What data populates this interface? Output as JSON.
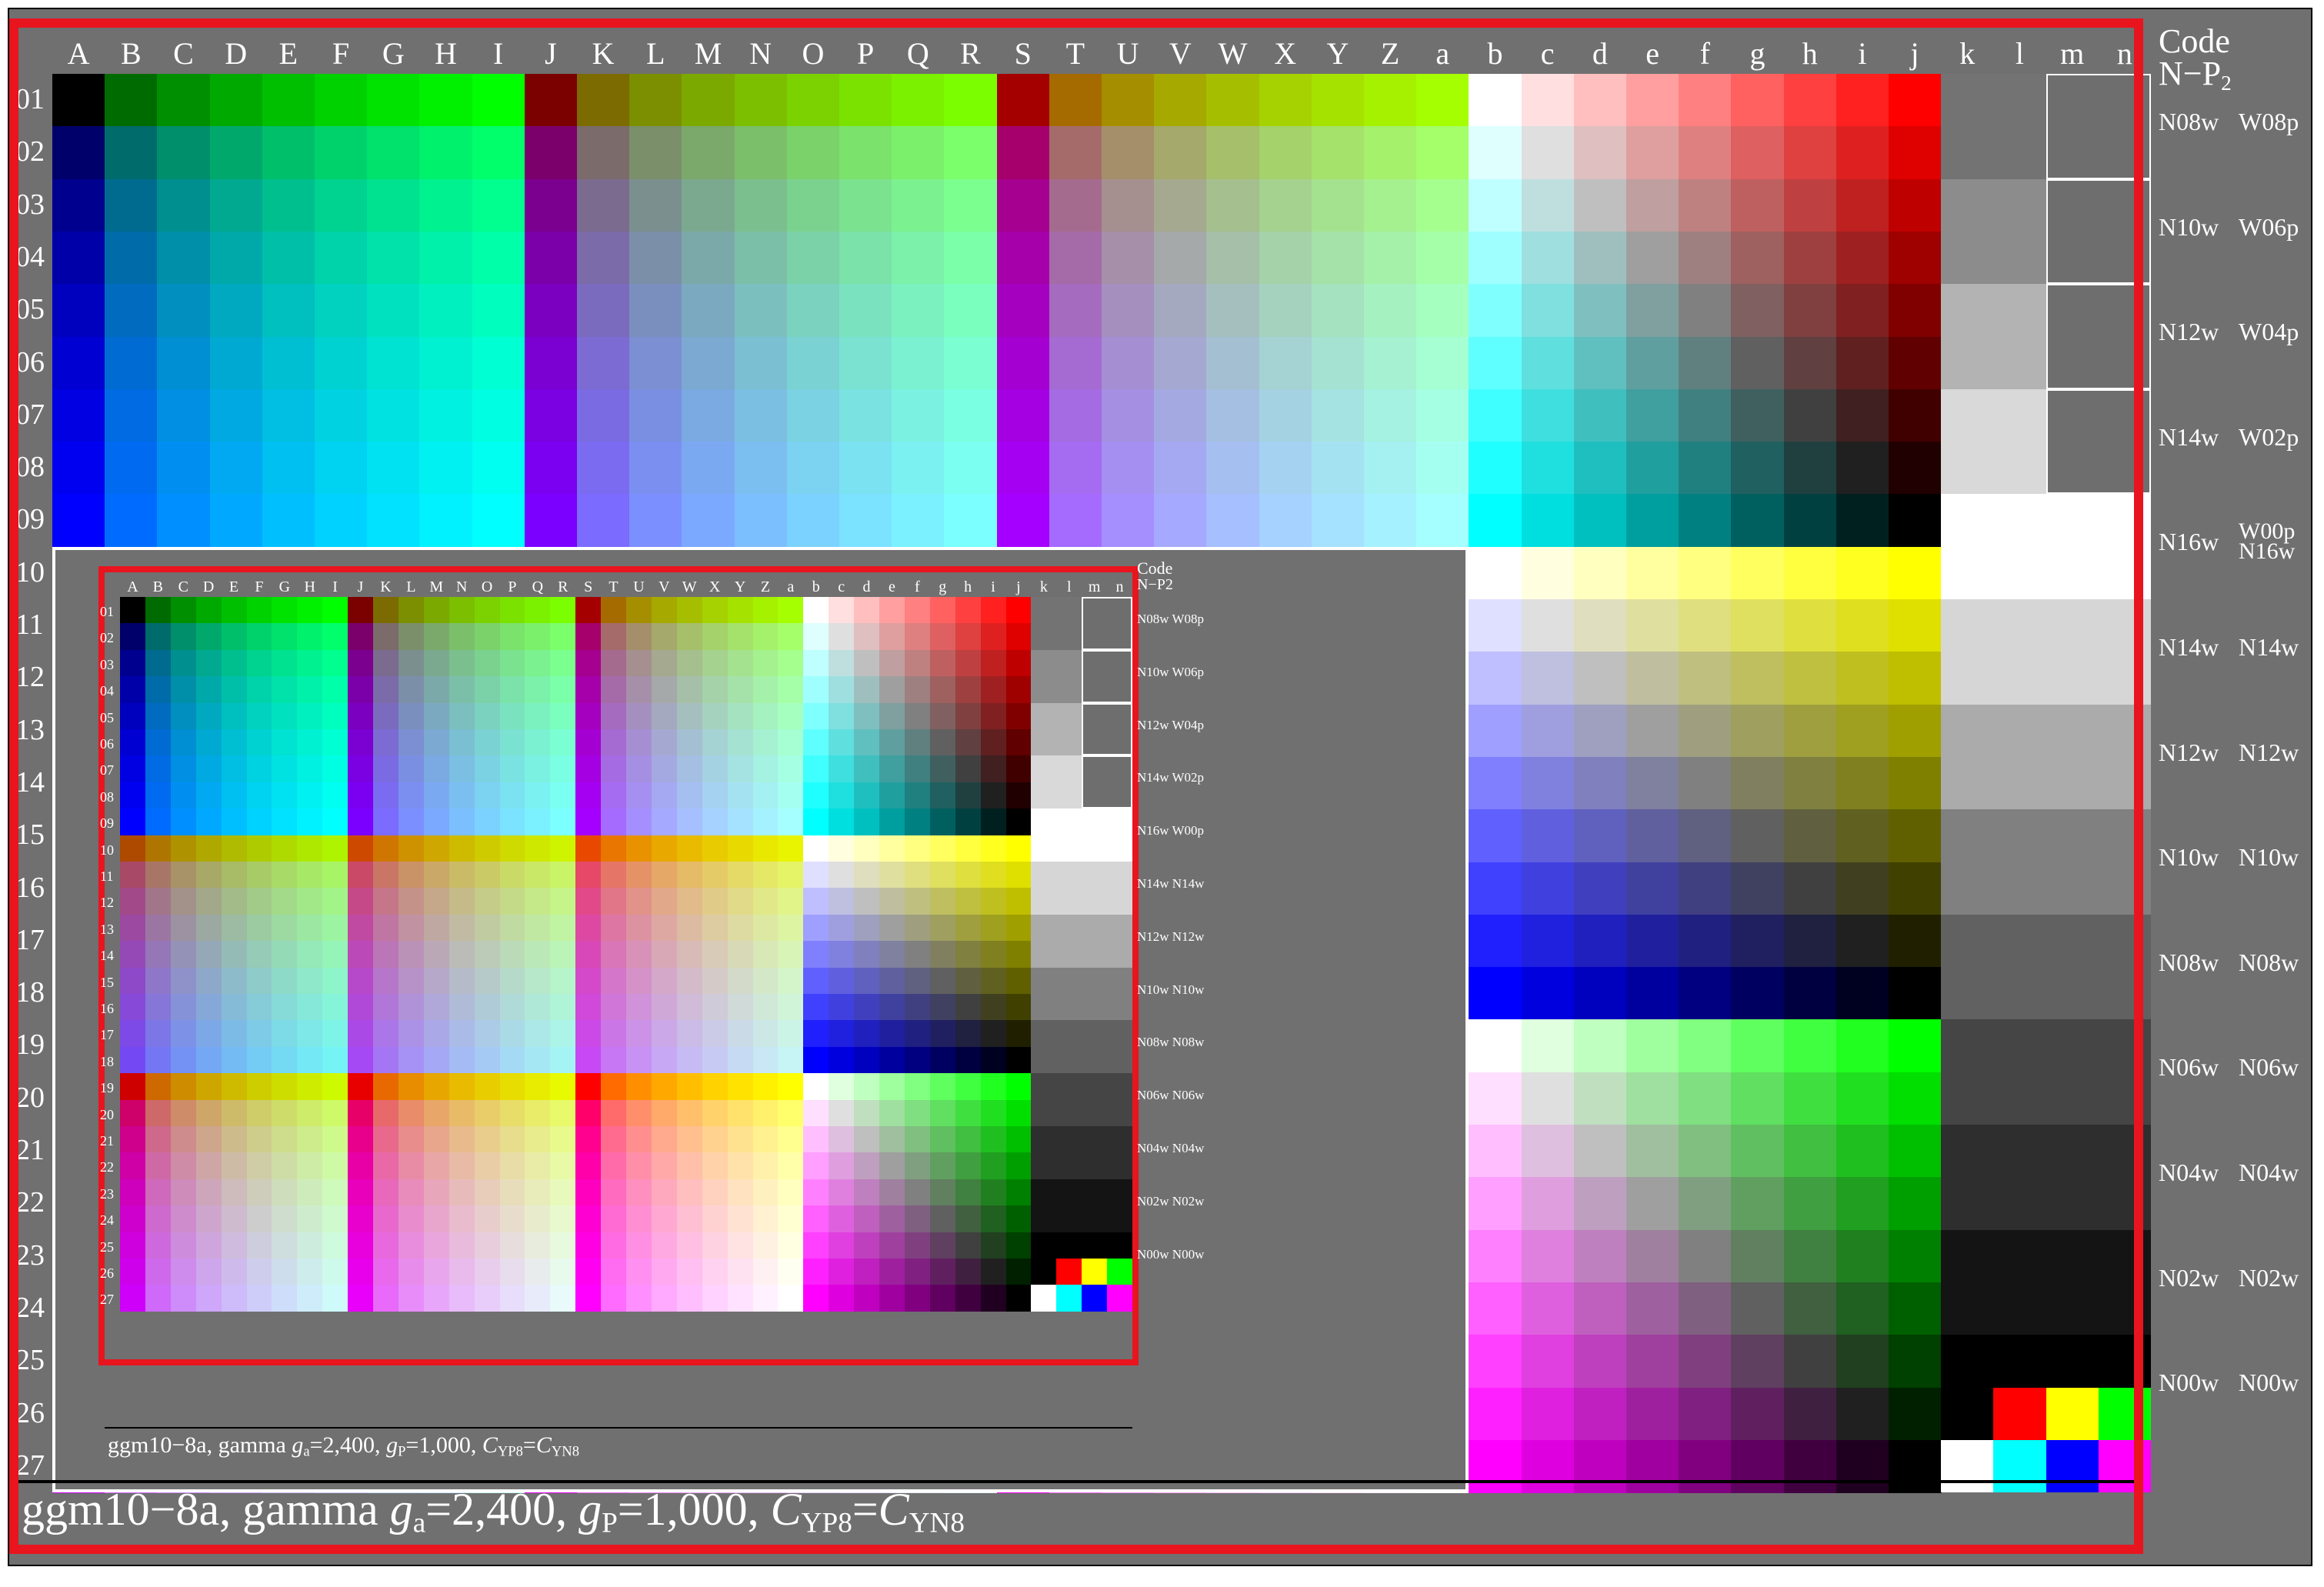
{
  "columns": [
    "A",
    "B",
    "C",
    "D",
    "E",
    "F",
    "G",
    "H",
    "I",
    "J",
    "K",
    "L",
    "M",
    "N",
    "O",
    "P",
    "Q",
    "R",
    "S",
    "T",
    "U",
    "V",
    "W",
    "X",
    "Y",
    "Z",
    "a",
    "b",
    "c",
    "d",
    "e",
    "f",
    "g",
    "h",
    "i",
    "j",
    "k",
    "l",
    "m",
    "n"
  ],
  "rows_big": [
    "01",
    "02",
    "03",
    "04",
    "05",
    "06",
    "07",
    "08",
    "09",
    "10",
    "11",
    "12",
    "13",
    "14",
    "15",
    "16",
    "17",
    "18",
    "19",
    "20",
    "21",
    "22",
    "23",
    "24",
    "25",
    "26",
    "27"
  ],
  "rows_small": [
    "01",
    "02",
    "03",
    "04",
    "05",
    "06",
    "07",
    "08",
    "09",
    "10",
    "11",
    "12",
    "13",
    "14",
    "15",
    "16",
    "17",
    "18",
    "19",
    "20",
    "21",
    "22",
    "23",
    "24",
    "25",
    "26",
    "27"
  ],
  "code_header": {
    "line1": "Code",
    "line2": "N−P",
    "sub": "2"
  },
  "right_labels": [
    [
      "N08w",
      "W08p"
    ],
    [
      "N10w",
      "W06p"
    ],
    [
      "N12w",
      "W04p"
    ],
    [
      "N14w",
      "W02p"
    ],
    [
      "N16w",
      "W00p",
      "N16w"
    ],
    [
      "N14w",
      "N14w"
    ],
    [
      "N12w",
      "N12w"
    ],
    [
      "N10w",
      "N10w"
    ],
    [
      "N08w",
      "N08w"
    ],
    [
      "N06w",
      "N06w"
    ],
    [
      "N04w",
      "N04w"
    ],
    [
      "N02w",
      "N02w"
    ],
    [
      "N00w",
      "N00w"
    ]
  ],
  "caption": {
    "name": "ggm10−8a, gamma ",
    "ga_sym": "g",
    "ga_sub": "a",
    "ga_val": "=2,400, ",
    "gp_sym": "g",
    "gp_sub": "P",
    "gp_val": "=1,000, ",
    "c1_sym": "C",
    "c1_sub": "YP8",
    "eq": "=",
    "c2_sym": "C",
    "c2_sub": "YN8"
  },
  "colors": {
    "frame_red": "#e8141e",
    "background_gray": "#707070",
    "special_patches_top": [
      "#ff0000",
      "#ffff00",
      "#00ff00"
    ],
    "special_patches_bottom": [
      "#ffffff",
      "#00ffff",
      "#0000ff",
      "#ff00ff"
    ]
  }
}
